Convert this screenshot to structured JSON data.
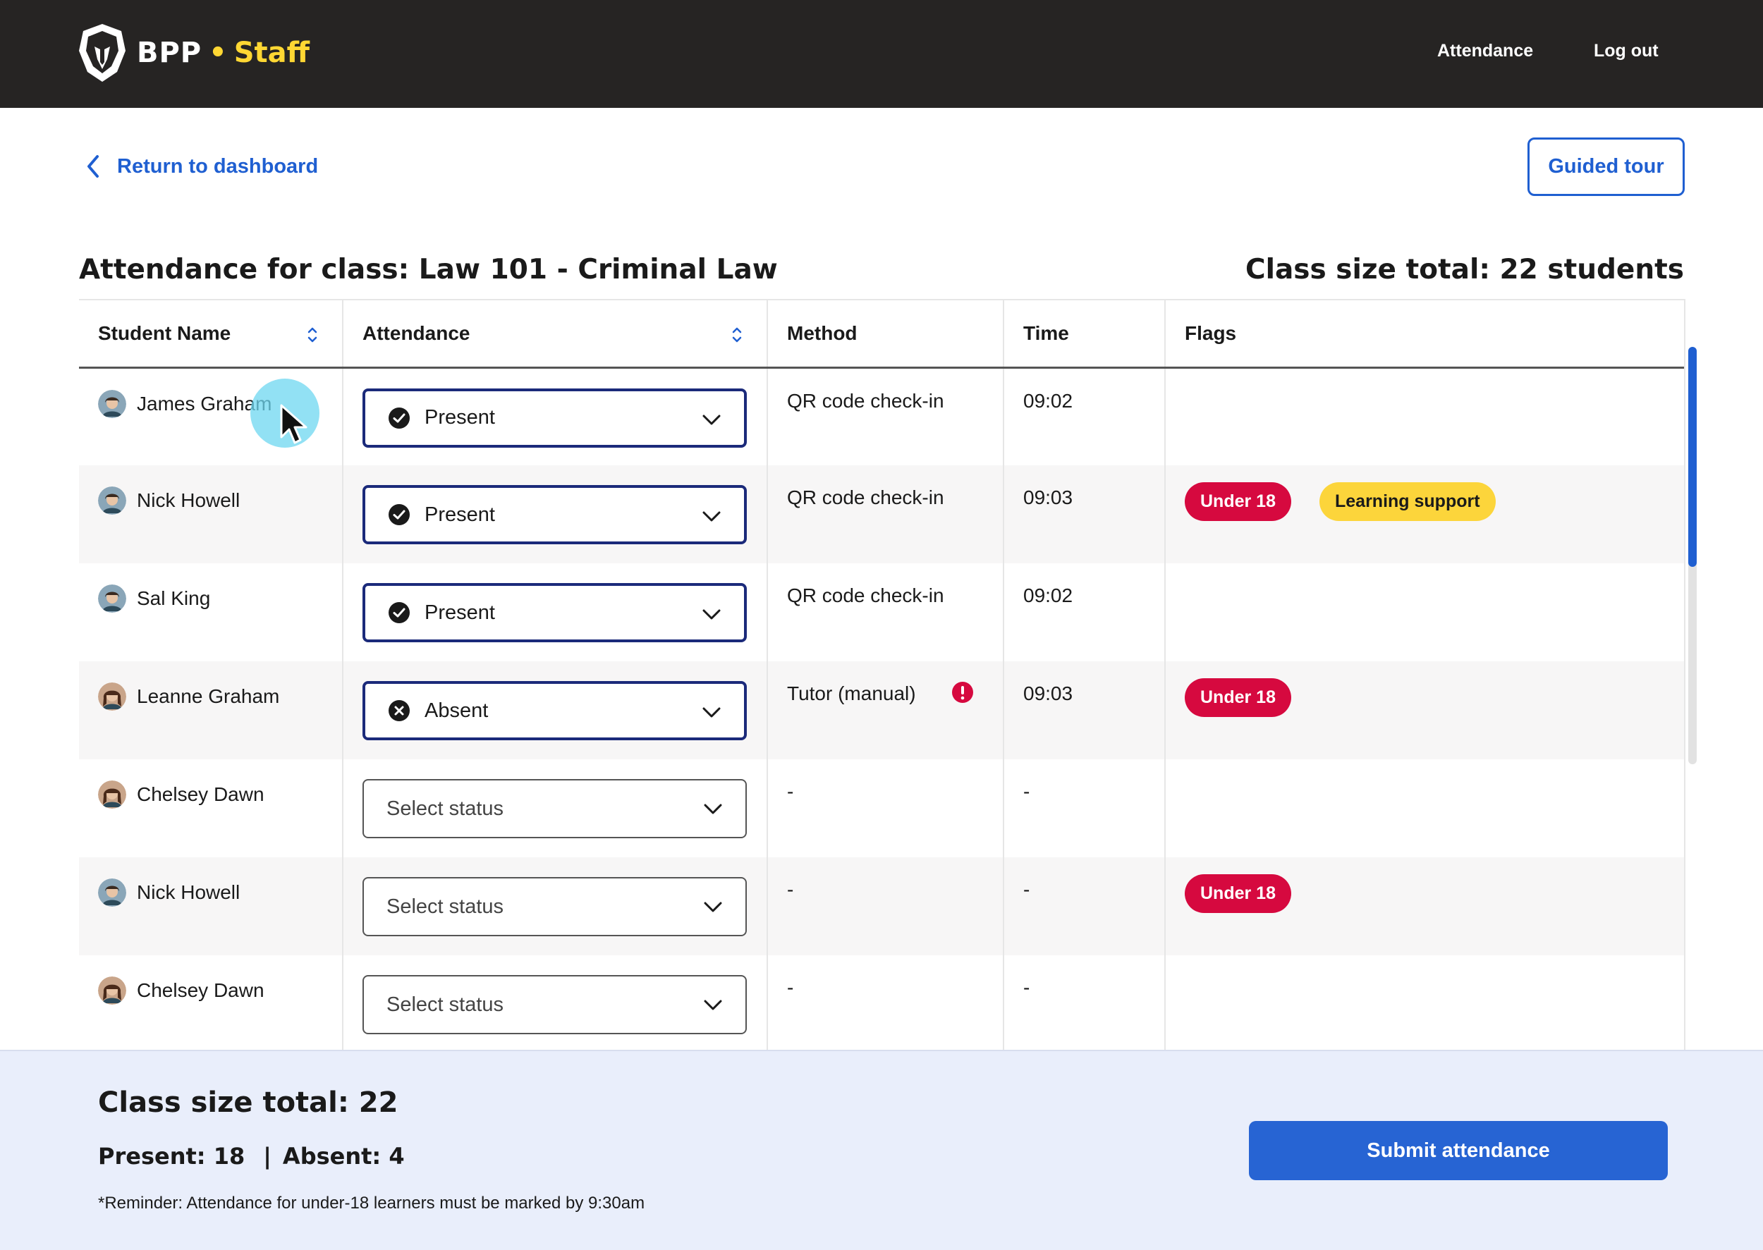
{
  "header": {
    "brand": "BPP",
    "separator": "•",
    "section": "Staff",
    "nav": [
      {
        "label": "Attendance"
      },
      {
        "label": "Log out"
      }
    ]
  },
  "subheader": {
    "back_label": "Return to dashboard",
    "tour_label": "Guided tour"
  },
  "page": {
    "title": "Attendance for class: Law 101 - Criminal Law",
    "class_size": "Class size total: 22 students"
  },
  "table": {
    "columns": [
      "Student Name",
      "Attendance",
      "Method",
      "Time",
      "Flags"
    ],
    "rows": [
      {
        "name": "James Graham",
        "status": "Present",
        "status_icon": "check-circle-icon",
        "method": "QR code check-in",
        "method_warning": false,
        "time": "09:02",
        "flags": [],
        "avatar": "male",
        "alt": false
      },
      {
        "name": "Nick Howell",
        "status": "Present",
        "status_icon": "check-circle-icon",
        "method": "QR code check-in",
        "method_warning": false,
        "time": "09:03",
        "flags": [
          {
            "label": "Under 18",
            "color": "#d6093f"
          },
          {
            "label": "Learning support",
            "color": "#fcd53b"
          }
        ],
        "avatar": "male",
        "alt": true
      },
      {
        "name": "Sal King",
        "status": "Present",
        "status_icon": "check-circle-icon",
        "method": "QR code check-in",
        "method_warning": false,
        "time": "09:02",
        "flags": [],
        "avatar": "male",
        "alt": false
      },
      {
        "name": "Leanne Graham",
        "status": "Absent",
        "status_icon": "x-circle-icon",
        "method": "Tutor (manual)",
        "method_warning": true,
        "time": "09:03",
        "flags": [
          {
            "label": "Under 18",
            "color": "#d6093f"
          }
        ],
        "avatar": "female",
        "alt": true
      },
      {
        "name": "Chelsey Dawn",
        "status": "Select status",
        "status_icon": null,
        "method": "-",
        "method_warning": false,
        "time": "-",
        "flags": [],
        "avatar": "female",
        "alt": false
      },
      {
        "name": "Nick Howell",
        "status": "Select status",
        "status_icon": null,
        "method": "-",
        "method_warning": false,
        "time": "-",
        "flags": [
          {
            "label": "Under 18",
            "color": "#d6093f"
          }
        ],
        "avatar": "male",
        "alt": true
      },
      {
        "name": "Chelsey Dawn",
        "status": "Select status",
        "status_icon": null,
        "method": "-",
        "method_warning": false,
        "time": "-",
        "flags": [],
        "avatar": "female",
        "alt": false
      }
    ]
  },
  "footer": {
    "total": "Class size total: 22",
    "present": "Present: 18",
    "divider": "|",
    "absent": "Absent: 4",
    "reminder": "*Reminder: Attendance for under-18 learners must be marked by 9:30am",
    "submit_label": "Submit attendance"
  },
  "colors": {
    "header_bg": "#262423",
    "brand_accent": "#ffd733",
    "link_blue": "#1f5fd1",
    "select_border": "#1b2a7a",
    "badge_red": "#d6093f",
    "badge_yellow": "#fcd53b",
    "footer_bg": "#e9eefb",
    "submit_bg": "#2764d3"
  }
}
